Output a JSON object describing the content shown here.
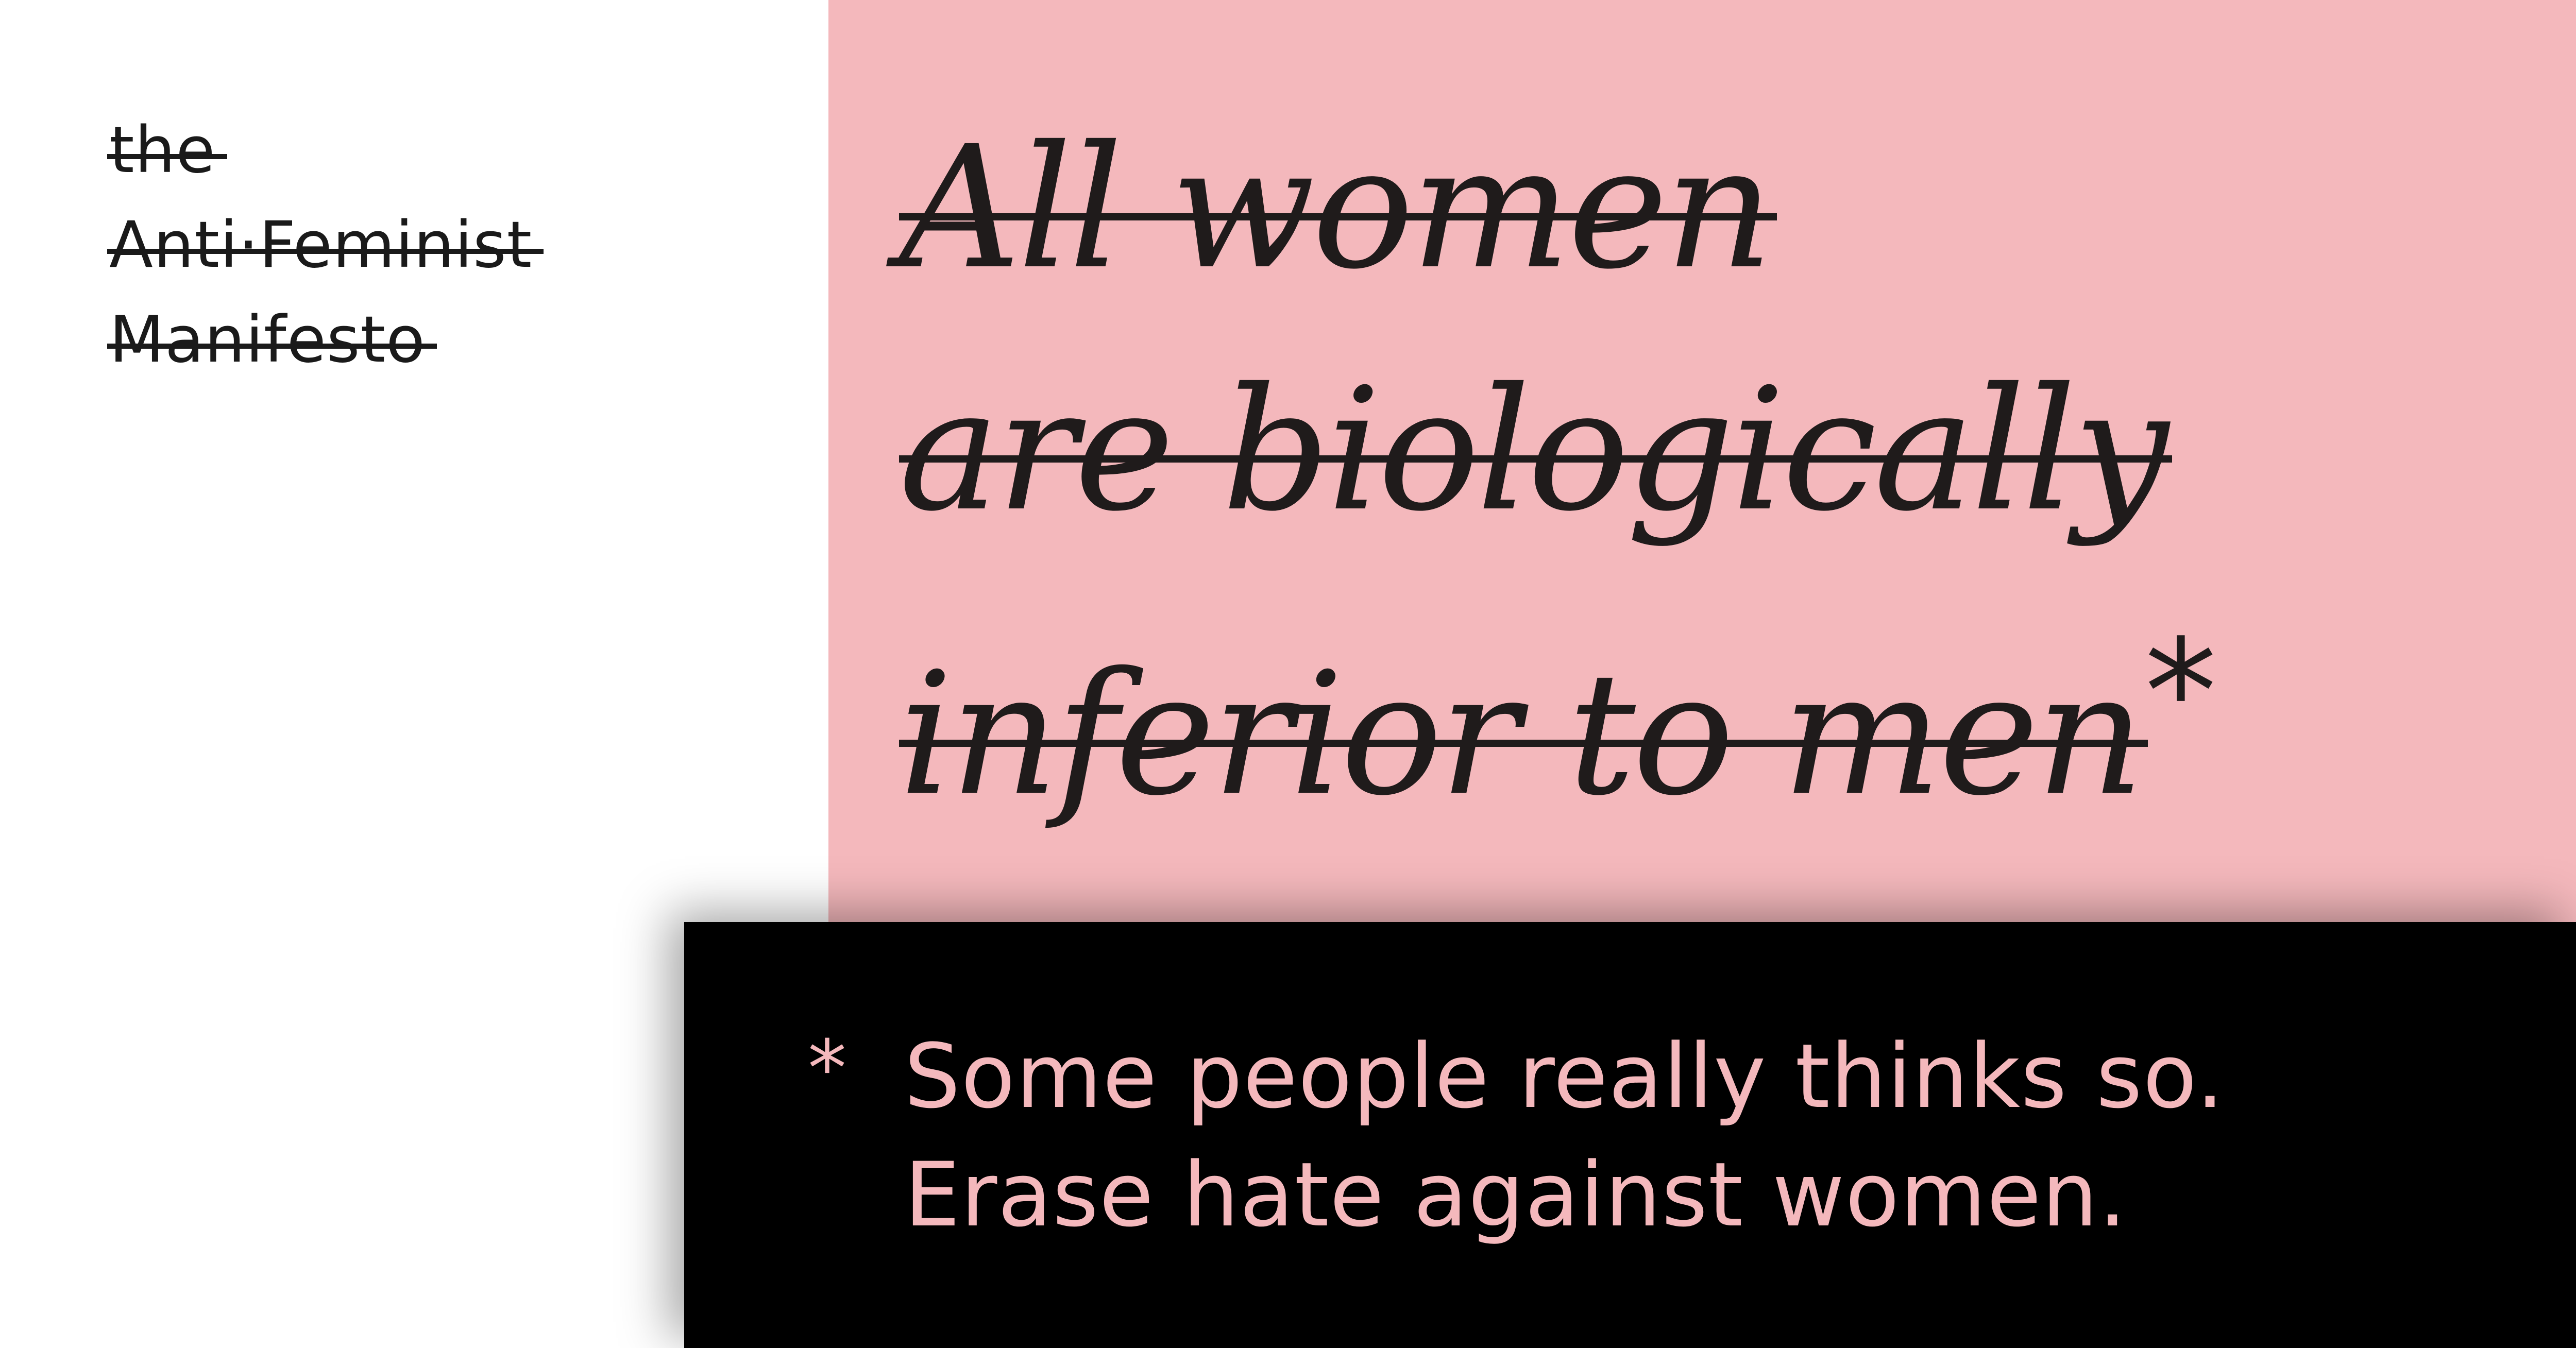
{
  "logo": {
    "line1": "the",
    "line2": "Anti·Feminist",
    "line3": "Manifesto"
  },
  "headline": {
    "line1": "All women",
    "line2": "are biologically",
    "line3": "inferior to men",
    "asterisk": "*"
  },
  "footnote": {
    "marker": "*",
    "line1": "Some people really thinks so.",
    "line2": "Erase hate against women."
  },
  "colors": {
    "pink": "#f4b8bc",
    "black": "#000000",
    "ink": "#1f1b1b",
    "white": "#ffffff"
  }
}
